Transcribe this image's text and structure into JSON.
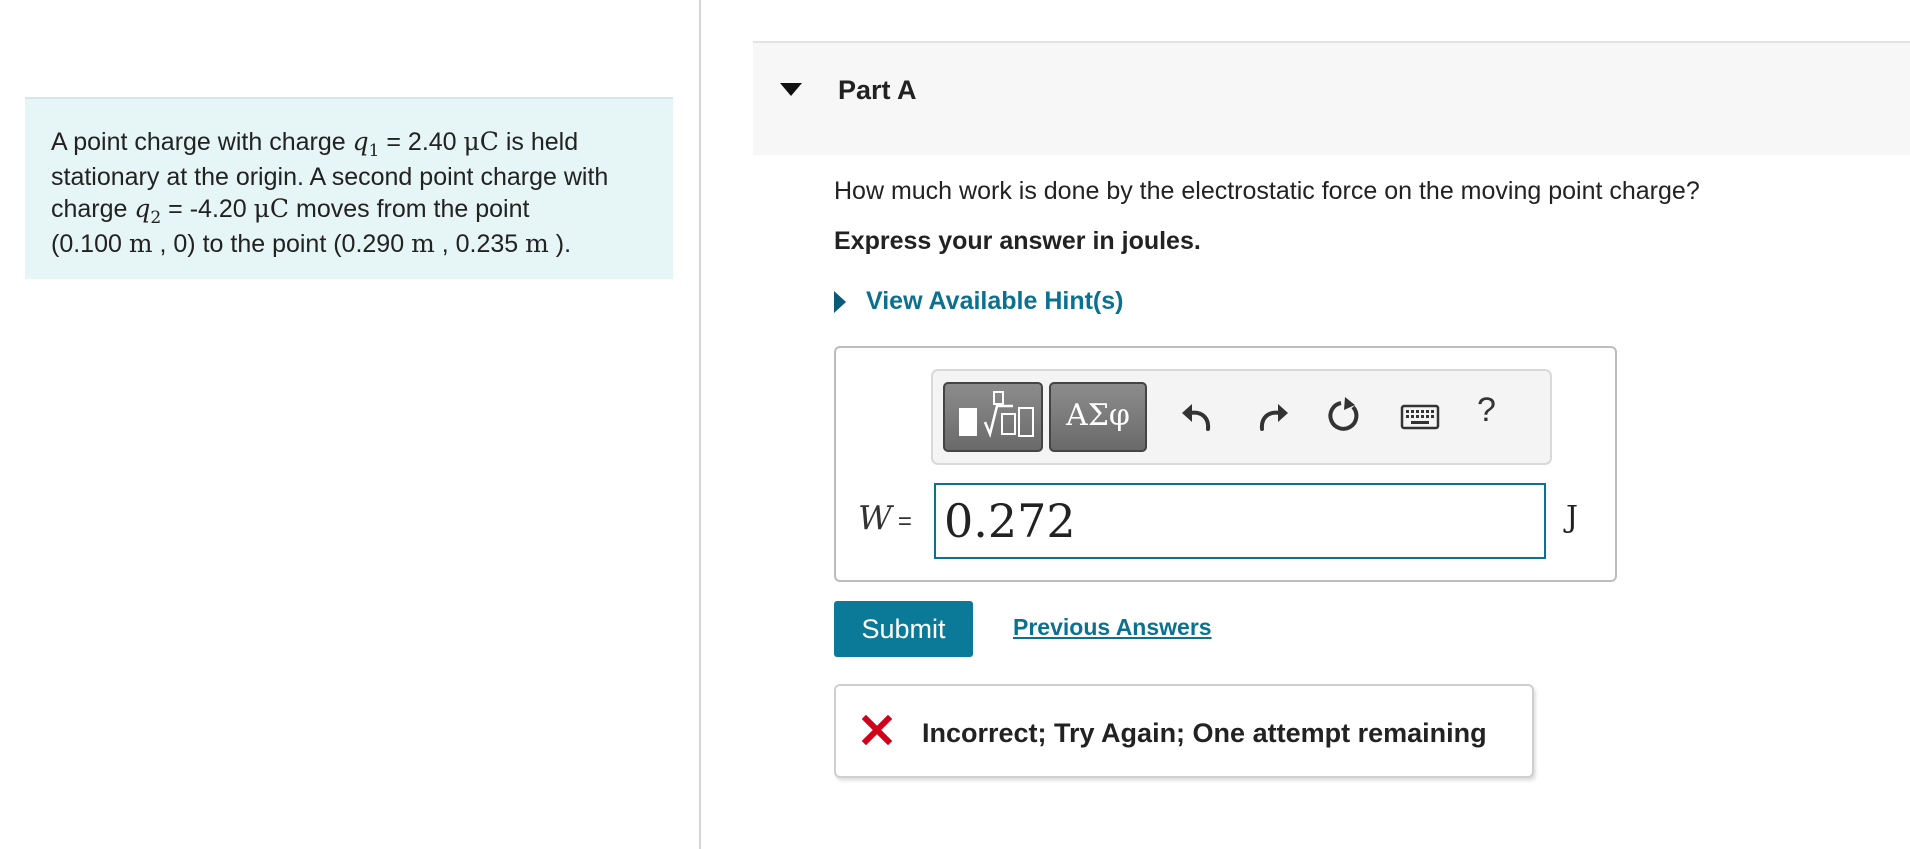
{
  "problem": {
    "line1_pre": "A point charge with charge ",
    "q1_var": "q",
    "q1_sub": "1",
    "q1_eq": " = 2.40 ",
    "q1_unit": "μC",
    "line1_post": " is held",
    "line2": "stationary at the origin. A second point charge with",
    "line3_pre": "charge ",
    "q2_var": "q",
    "q2_sub": "2",
    "q2_eq": " = -4.20 ",
    "q2_unit": "μC",
    "line3_post": " moves from the point",
    "p1_open": "(0.100 ",
    "p1_unit": "m",
    "p1_close": " , 0) to the point (0.290 ",
    "p2_unit1": "m",
    "p2_mid": " , 0.235 ",
    "p2_unit2": "m",
    "p2_close": " )."
  },
  "part": {
    "title": "Part A"
  },
  "question": "How much work is done by the electrostatic force on the moving point charge?",
  "instruction": "Express your answer in joules.",
  "hint_toggle": "View Available Hint(s)",
  "toolbar": {
    "greek_label": "ΑΣφ",
    "help_label": "?",
    "icons": [
      "templates-icon",
      "greek-symbols-icon",
      "undo-icon",
      "redo-icon",
      "reset-icon",
      "keyboard-icon",
      "help-icon"
    ]
  },
  "answer": {
    "variable": "W",
    "equals": "=",
    "value": "0.272",
    "unit": "J"
  },
  "submit_label": "Submit",
  "previous_answers_label": "Previous Answers",
  "feedback": {
    "text": "Incorrect; Try Again; One attempt remaining",
    "icon": "x-icon",
    "icon_color": "#d0021b"
  },
  "colors": {
    "accent": "#0b7191",
    "submit_bg": "#0b7a99",
    "problem_bg": "#e6f5f5"
  }
}
